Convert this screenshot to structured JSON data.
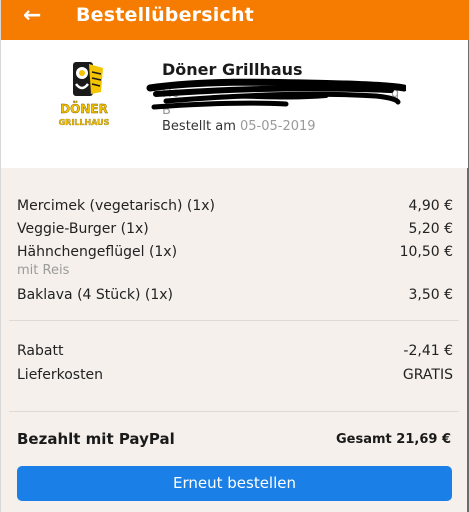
{
  "header": {
    "back_icon": "←",
    "title": "Bestellübersicht",
    "color": "#f57c00"
  },
  "restaurant": {
    "name": "Döner Grillhaus",
    "address_line1": "Ho",
    "address_line2": "B",
    "address_suffix": "g",
    "ordered_label": "Bestellt am",
    "ordered_date": "05-05-2019",
    "logo_text_line1": "DÖNER",
    "logo_text_line2": "GRILLHAUS"
  },
  "items": [
    {
      "name": "Mercimek (vegetarisch) (1x)",
      "price": "4,90 €"
    },
    {
      "name": "Veggie-Burger (1x)",
      "price": "5,20 €"
    },
    {
      "name": "Hähnchengeflügel (1x)",
      "price": "10,50 €",
      "note": "mit Reis"
    },
    {
      "name": "Baklava (4 Stück) (1x)",
      "price": "3,50 €"
    }
  ],
  "costs": {
    "discount_label": "Rabatt",
    "discount_value": "-2,41 €",
    "delivery_label": "Lieferkosten",
    "delivery_value": "GRATIS"
  },
  "payment": {
    "paid_with": "Bezahlt mit PayPal",
    "total": "Gesamt 21,69 €"
  },
  "button": {
    "reorder_label": "Erneut bestellen",
    "color": "#1a7fe6"
  }
}
